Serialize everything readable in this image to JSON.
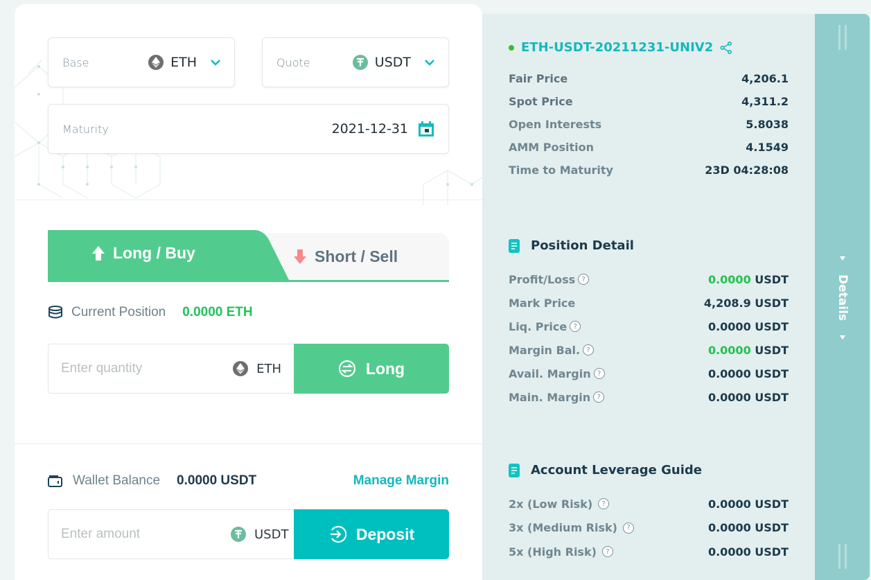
{
  "selectors": {
    "base": {
      "label": "Base",
      "value": "ETH",
      "icon": "eth-icon"
    },
    "quote": {
      "label": "Quote",
      "value": "USDT",
      "icon": "usdt-icon"
    },
    "maturity": {
      "label": "Maturity",
      "value": "2021-12-31",
      "icon": "calendar-icon"
    }
  },
  "tabs": {
    "long": {
      "label": "Long / Buy",
      "icon": "arrow-up-icon",
      "active": true
    },
    "short": {
      "label": "Short / Sell",
      "icon": "arrow-down-icon",
      "active": false
    }
  },
  "position": {
    "label": "Current Position",
    "value": "0.0000 ETH"
  },
  "quantity_input": {
    "placeholder": "Enter quantity",
    "value": "",
    "unit": "ETH"
  },
  "long_button": {
    "label": "Long"
  },
  "wallet": {
    "label": "Wallet Balance",
    "value": "0.0000 USDT",
    "manage_link": "Manage Margin"
  },
  "amount_input": {
    "placeholder": "Enter amount",
    "value": "",
    "unit": "USDT"
  },
  "deposit_button": {
    "label": "Deposit"
  },
  "contract": {
    "name": "ETH-USDT-20211231-UNIV2",
    "status_color": "#37c025"
  },
  "market_info": [
    {
      "label": "Fair Price",
      "value": "4,206.1"
    },
    {
      "label": "Spot Price",
      "value": "4,311.2"
    },
    {
      "label": "Open Interests",
      "value": "5.8038"
    },
    {
      "label": "AMM Position",
      "value": "4.1549"
    },
    {
      "label": "Time to Maturity",
      "value": "23D 04:28:08"
    }
  ],
  "position_detail": {
    "title": "Position Detail",
    "rows": [
      {
        "label": "Profit/Loss",
        "value": "0.0000",
        "unit": "USDT",
        "help": true,
        "green": true
      },
      {
        "label": "Mark Price",
        "value": "4,208.9",
        "unit": "USDT",
        "help": false,
        "green": false
      },
      {
        "label": "Liq. Price",
        "value": "0.0000",
        "unit": "USDT",
        "help": true,
        "green": false
      },
      {
        "label": "Margin Bal.",
        "value": "0.0000",
        "unit": "USDT",
        "help": true,
        "green": true
      },
      {
        "label": "Avail. Margin",
        "value": "0.0000",
        "unit": "USDT",
        "help": true,
        "green": false
      },
      {
        "label": "Main. Margin",
        "value": "0.0000",
        "unit": "USDT",
        "help": true,
        "green": false
      }
    ]
  },
  "leverage_guide": {
    "title": "Account Leverage Guide",
    "rows": [
      {
        "label": "2x (Low Risk)",
        "value": "0.0000 USDT"
      },
      {
        "label": "3x (Medium Risk)",
        "value": "0.0000 USDT"
      },
      {
        "label": "5x (High Risk)",
        "value": "0.0000 USDT"
      }
    ]
  },
  "details_toggle": {
    "label": "Details"
  },
  "colors": {
    "accent": "#13b8bd",
    "long_green": "#52cc8e",
    "deposit_teal": "#00bfbf",
    "positive_green": "#21c250",
    "short_red": "#f48a8a",
    "details_strip": "#90cccc"
  }
}
